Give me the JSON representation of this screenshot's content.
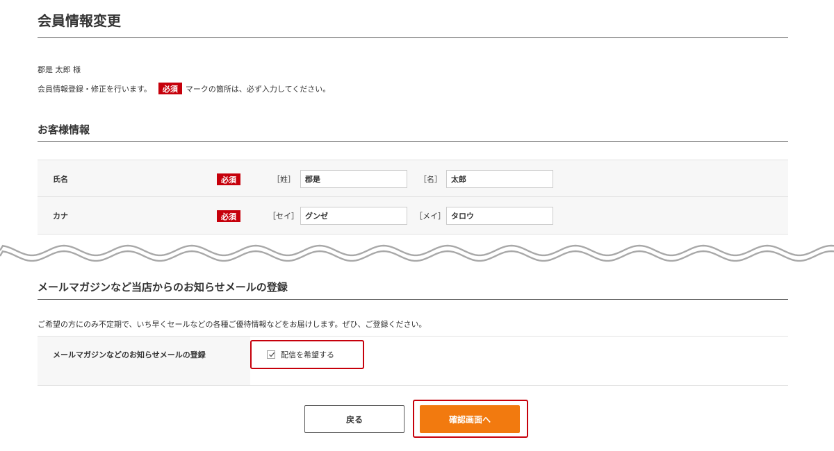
{
  "page": {
    "title": "会員情報変更"
  },
  "greeting": "郡是 太郎 様",
  "notice": {
    "before": "会員情報登録・修正を行います。",
    "badge": "必須",
    "after": "マークの箇所は、必ず入力してください。"
  },
  "customer_section": {
    "title": "お客様情報",
    "rows": [
      {
        "label": "氏名",
        "badge": "必須",
        "field1_label": "［姓］",
        "field1_value": "郡是",
        "field2_label": "［名］",
        "field2_value": "太郎"
      },
      {
        "label": "カナ",
        "badge": "必須",
        "field1_label": "［セイ］",
        "field1_value": "グンゼ",
        "field2_label": "［メイ］",
        "field2_value": "タロウ"
      }
    ]
  },
  "mail_section": {
    "title": "メールマガジンなど当店からのお知らせメールの登録",
    "description": "ご希望の方にのみ不定期で、いち早くセールなどの各種ご優待情報などをお届けします。ぜひ、ご登録ください。",
    "row_label": "メールマガジンなどのお知らせメールの登録",
    "checkbox_label": "配信を希望する",
    "checkbox_checked": true
  },
  "buttons": {
    "back": "戻る",
    "confirm": "確認画面へ"
  },
  "colors": {
    "required_badge": "#c6000b",
    "confirm_button": "#f27a0f",
    "highlight": "#c6000b"
  }
}
